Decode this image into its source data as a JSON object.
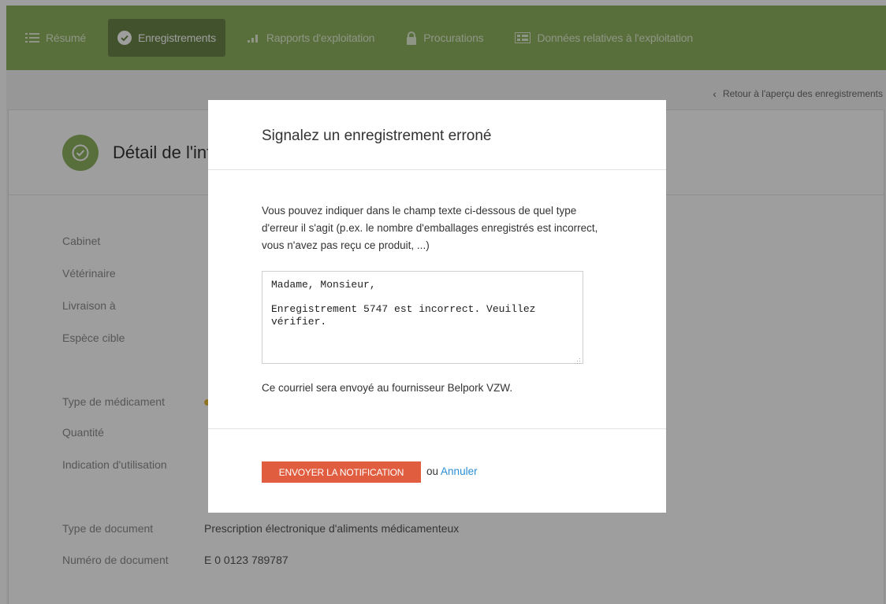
{
  "nav": {
    "items": [
      {
        "label": "Résumé",
        "icon": "list-icon",
        "active": false
      },
      {
        "label": "Enregistrements",
        "icon": "check-circle-icon",
        "active": true
      },
      {
        "label": "Rapports d'exploitation",
        "icon": "bar-chart-icon",
        "active": false
      },
      {
        "label": "Procurations",
        "icon": "lock-icon",
        "active": false
      },
      {
        "label": "Données relatives à l'exploitation",
        "icon": "table-icon",
        "active": false
      }
    ]
  },
  "page": {
    "back_link": "Retour à l'aperçu des enregistrements",
    "title": "Détail de l'inf",
    "fields": [
      {
        "label": "Cabinet",
        "value": ""
      },
      {
        "label": "Vétérinaire",
        "value": ""
      },
      {
        "label": "Livraison à",
        "value": ""
      },
      {
        "label": "Espèce cible",
        "value": ""
      },
      {
        "label": "Type de médicament",
        "value": ""
      },
      {
        "label": "Quantité",
        "value": ""
      },
      {
        "label": "Indication d'utilisation",
        "value": ""
      },
      {
        "label": "Type de document",
        "value": "Prescription électronique d'aliments médicamenteux"
      },
      {
        "label": "Numéro de document",
        "value": "E 0 0123 789787"
      }
    ]
  },
  "modal": {
    "title": "Signalez un enregistrement erroné",
    "instructions": "Vous pouvez indiquer dans le champ texte ci-dessous de quel type d'erreur il s'agit (p.ex. le nombre d'emballages enregistrés est incorrect, vous n'avez pas reçu ce produit, ...)",
    "message": "Madame, Monsieur,\n\nEnregistrement 5747 est incorrect. Veuillez vérifier.",
    "note": "Ce courriel sera envoyé au fournisseur Belpork VZW.",
    "send_label": "ENVOYER LA NOTIFICATION",
    "or_label": "ou",
    "cancel_label": "Annuler"
  },
  "colors": {
    "nav_bg": "#8fb461",
    "nav_active": "#6a8548",
    "send_button": "#e05d3f",
    "cancel_link": "#2a8fd6"
  }
}
